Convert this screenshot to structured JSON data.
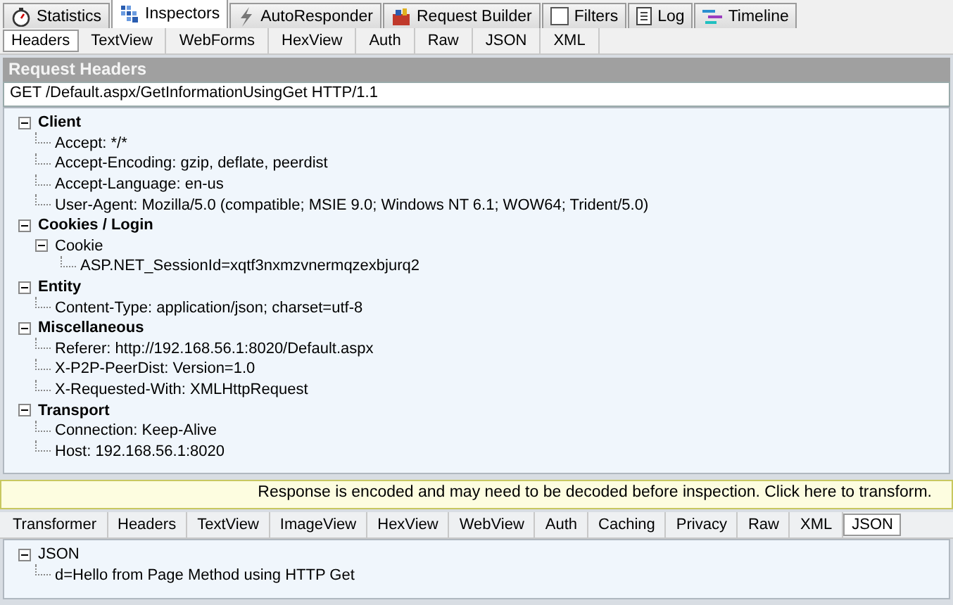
{
  "main_tabs": [
    {
      "label": "Statistics",
      "kind": "stopwatch",
      "selected": false
    },
    {
      "label": "Inspectors",
      "kind": "grid",
      "selected": true
    },
    {
      "label": "AutoResponder",
      "kind": "bolt",
      "selected": false
    },
    {
      "label": "Request Builder",
      "kind": "builder",
      "selected": false
    },
    {
      "label": "Filters",
      "kind": "checkbox",
      "selected": false
    },
    {
      "label": "Log",
      "kind": "document",
      "selected": false
    },
    {
      "label": "Timeline",
      "kind": "bars",
      "selected": false
    }
  ],
  "request_tabs": [
    {
      "label": "Headers",
      "selected": true
    },
    {
      "label": "TextView",
      "selected": false
    },
    {
      "label": "WebForms",
      "selected": false
    },
    {
      "label": "HexView",
      "selected": false
    },
    {
      "label": "Auth",
      "selected": false
    },
    {
      "label": "Raw",
      "selected": false
    },
    {
      "label": "JSON",
      "selected": false
    },
    {
      "label": "XML",
      "selected": false
    }
  ],
  "request_headers": {
    "title": "Request Headers",
    "request_line": "GET /Default.aspx/GetInformationUsingGet HTTP/1.1",
    "groups": [
      {
        "label": "Client",
        "expanded": true,
        "children": [
          {
            "label": "Accept: */*"
          },
          {
            "label": "Accept-Encoding: gzip, deflate, peerdist"
          },
          {
            "label": "Accept-Language: en-us"
          },
          {
            "label": "User-Agent: Mozilla/5.0 (compatible; MSIE 9.0; Windows NT 6.1; WOW64; Trident/5.0)"
          }
        ]
      },
      {
        "label": "Cookies / Login",
        "expanded": true,
        "children": [
          {
            "label": "Cookie",
            "expanded": true,
            "children": [
              {
                "label": "ASP.NET_SessionId=xqtf3nxmzvnermqzexbjurq2"
              }
            ]
          }
        ]
      },
      {
        "label": "Entity",
        "expanded": true,
        "children": [
          {
            "label": "Content-Type: application/json; charset=utf-8"
          }
        ]
      },
      {
        "label": "Miscellaneous",
        "expanded": true,
        "children": [
          {
            "label": "Referer: http://192.168.56.1:8020/Default.aspx"
          },
          {
            "label": "X-P2P-PeerDist: Version=1.0"
          },
          {
            "label": "X-Requested-With: XMLHttpRequest"
          }
        ]
      },
      {
        "label": "Transport",
        "expanded": true,
        "children": [
          {
            "label": "Connection: Keep-Alive"
          },
          {
            "label": "Host: 192.168.56.1:8020"
          }
        ]
      }
    ]
  },
  "notice": "Response is encoded and may need to be decoded before inspection. Click here to transform.",
  "response_tabs": [
    {
      "label": "Transformer",
      "selected": false
    },
    {
      "label": "Headers",
      "selected": false
    },
    {
      "label": "TextView",
      "selected": false
    },
    {
      "label": "ImageView",
      "selected": false
    },
    {
      "label": "HexView",
      "selected": false
    },
    {
      "label": "WebView",
      "selected": false
    },
    {
      "label": "Auth",
      "selected": false
    },
    {
      "label": "Caching",
      "selected": false
    },
    {
      "label": "Privacy",
      "selected": false
    },
    {
      "label": "Raw",
      "selected": false
    },
    {
      "label": "XML",
      "selected": false
    },
    {
      "label": "JSON",
      "selected": true
    }
  ],
  "response_tree": [
    {
      "label": "JSON",
      "expanded": true,
      "children": [
        {
          "label": "d=Hello from Page Method using HTTP Get"
        }
      ]
    }
  ]
}
